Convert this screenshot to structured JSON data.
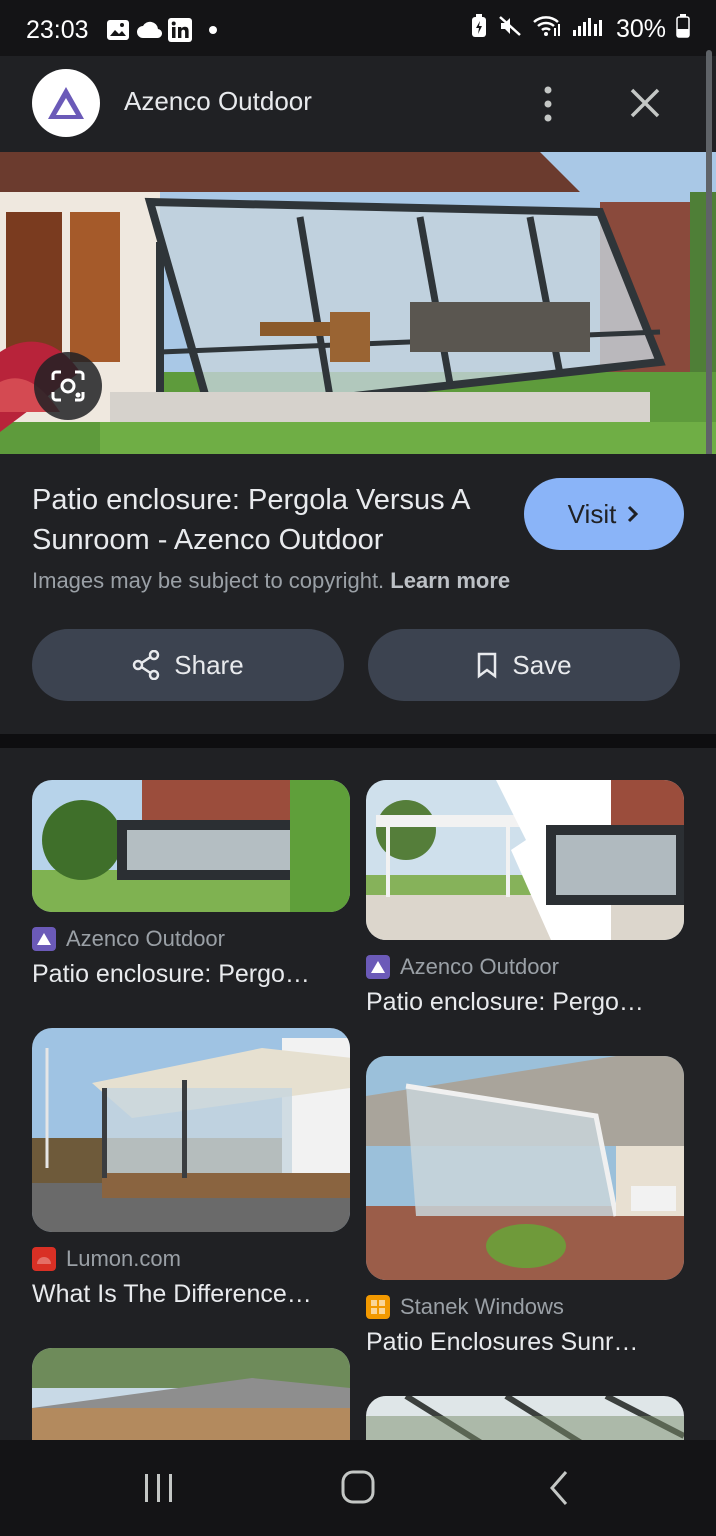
{
  "status": {
    "time": "23:03",
    "battery": "30%"
  },
  "header": {
    "title": "Azenco Outdoor"
  },
  "result": {
    "title": "Patio enclosure: Pergola Versus A Sunroom - Azenco Outdoor",
    "visit_label": "Visit",
    "copyright_text": "Images may be subject to copyright.",
    "learn_more": "Learn more",
    "share_label": "Share",
    "save_label": "Save"
  },
  "related": [
    {
      "source": "Azenco Outdoor",
      "caption": "Patio enclosure: Pergo…"
    },
    {
      "source": "Azenco Outdoor",
      "caption": "Patio enclosure: Pergo…"
    },
    {
      "source": "Lumon.com",
      "caption": "What Is The Difference…"
    },
    {
      "source": "Stanek Windows",
      "caption": "Patio Enclosures Sunr…"
    }
  ],
  "colors": {
    "accent": "#8ab4f8",
    "background": "#202124",
    "pill": "#3c4350",
    "azenco_brand": "#6b5ab8",
    "lumon_brand": "#d93025",
    "stanek_brand": "#f29900"
  },
  "icons": [
    "gallery-icon",
    "cloud-icon",
    "linkedin-icon",
    "battery-saver-icon",
    "mute-icon",
    "wifi-icon",
    "signal-icon",
    "battery-icon",
    "more-vert-icon",
    "close-icon",
    "lens-icon",
    "chevron-right-icon",
    "share-icon",
    "bookmark-icon",
    "recents-icon",
    "home-icon",
    "back-icon"
  ]
}
